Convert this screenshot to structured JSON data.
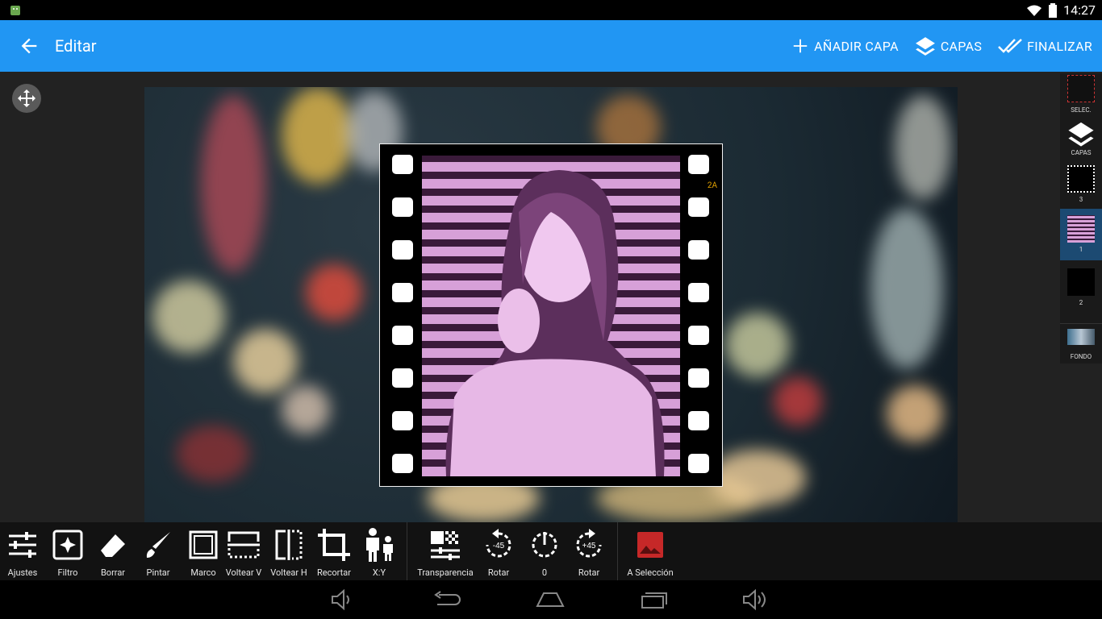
{
  "status_bar": {
    "time": "14:27"
  },
  "toolbar": {
    "title": "Editar",
    "actions": [
      {
        "label": "AÑADIR CAPA"
      },
      {
        "label": "CAPAS"
      },
      {
        "label": "FINALIZAR"
      }
    ]
  },
  "canvas": {
    "frame_tag": "2A"
  },
  "layers_panel": {
    "items": [
      {
        "label": "SELEC."
      },
      {
        "label": "CAPAS"
      },
      {
        "label": "3"
      },
      {
        "label": "1",
        "selected": true
      },
      {
        "label": "2"
      },
      {
        "label": "FONDO"
      }
    ]
  },
  "bottom_tools": [
    {
      "label": "Ajustes"
    },
    {
      "label": "Filtro"
    },
    {
      "label": "Borrar"
    },
    {
      "label": "Pintar"
    },
    {
      "label": "Marco"
    },
    {
      "label": "Voltear V"
    },
    {
      "label": "Voltear H"
    },
    {
      "label": "Recortar"
    },
    {
      "label": "X:Y"
    },
    {
      "label": "Transparencia"
    },
    {
      "label": "Rotar",
      "badge": "-45"
    },
    {
      "label": "0"
    },
    {
      "label": "Rotar",
      "badge": "+45"
    },
    {
      "label": "A Selección"
    }
  ],
  "colors": {
    "toolbar": "#2196f3",
    "selected_layer": "#1c4a72",
    "accent_red": "#c62828"
  }
}
